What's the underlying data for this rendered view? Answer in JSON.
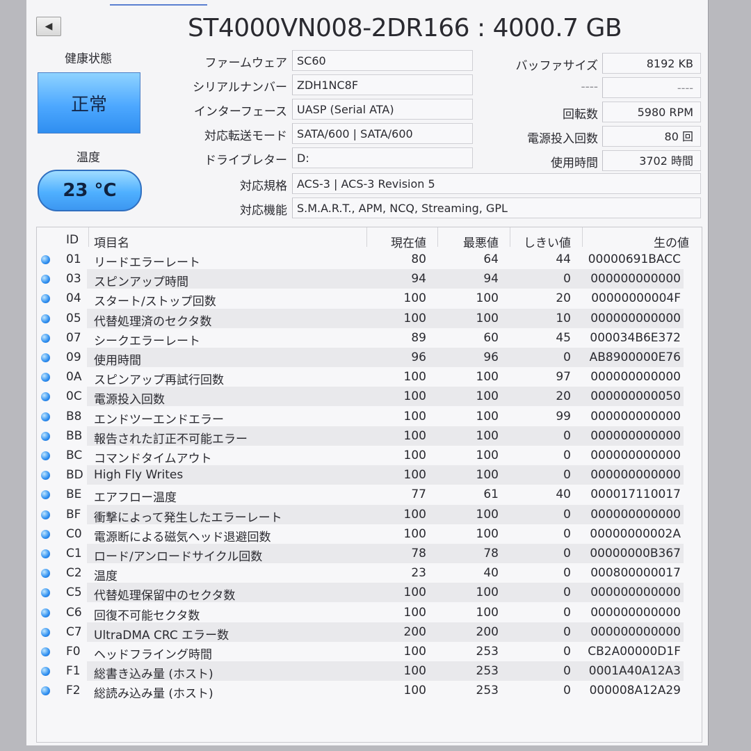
{
  "title": "ST4000VN008-2DR166 : 4000.7 GB",
  "health": {
    "label": "健康状態",
    "status": "正常"
  },
  "temperature": {
    "label": "温度",
    "value": "23 °C"
  },
  "info_left": [
    {
      "label": "ファームウェア",
      "value": "SC60"
    },
    {
      "label": "シリアルナンバー",
      "value": "ZDH1NC8F"
    },
    {
      "label": "インターフェース",
      "value": "UASP (Serial ATA)"
    },
    {
      "label": "対応転送モード",
      "value": "SATA/600 | SATA/600"
    },
    {
      "label": "ドライブレター",
      "value": "D:"
    },
    {
      "label": "対応規格",
      "value": "ACS-3 | ACS-3 Revision 5"
    },
    {
      "label": "対応機能",
      "value": "S.M.A.R.T., APM, NCQ, Streaming, GPL"
    }
  ],
  "info_right": [
    {
      "label": "バッファサイズ",
      "value": "8192 KB"
    },
    {
      "label": "----",
      "value": "----"
    },
    {
      "label": "回転数",
      "value": "5980 RPM"
    },
    {
      "label": "電源投入回数",
      "value": "80 回"
    },
    {
      "label": "使用時間",
      "value": "3702 時間"
    }
  ],
  "table": {
    "headers": {
      "id": "ID",
      "name": "項目名",
      "current": "現在値",
      "worst": "最悪値",
      "threshold": "しきい値",
      "raw": "生の値"
    },
    "rows": [
      {
        "id": "01",
        "name": "リードエラーレート",
        "current": "80",
        "worst": "64",
        "threshold": "44",
        "raw": "00000691BACC"
      },
      {
        "id": "03",
        "name": "スピンアップ時間",
        "current": "94",
        "worst": "94",
        "threshold": "0",
        "raw": "000000000000"
      },
      {
        "id": "04",
        "name": "スタート/ストップ回数",
        "current": "100",
        "worst": "100",
        "threshold": "20",
        "raw": "00000000004F"
      },
      {
        "id": "05",
        "name": "代替処理済のセクタ数",
        "current": "100",
        "worst": "100",
        "threshold": "10",
        "raw": "000000000000"
      },
      {
        "id": "07",
        "name": "シークエラーレート",
        "current": "89",
        "worst": "60",
        "threshold": "45",
        "raw": "000034B6E372"
      },
      {
        "id": "09",
        "name": "使用時間",
        "current": "96",
        "worst": "96",
        "threshold": "0",
        "raw": "AB8900000E76"
      },
      {
        "id": "0A",
        "name": "スピンアップ再試行回数",
        "current": "100",
        "worst": "100",
        "threshold": "97",
        "raw": "000000000000"
      },
      {
        "id": "0C",
        "name": "電源投入回数",
        "current": "100",
        "worst": "100",
        "threshold": "20",
        "raw": "000000000050"
      },
      {
        "id": "B8",
        "name": "エンドツーエンドエラー",
        "current": "100",
        "worst": "100",
        "threshold": "99",
        "raw": "000000000000"
      },
      {
        "id": "BB",
        "name": "報告された訂正不可能エラー",
        "current": "100",
        "worst": "100",
        "threshold": "0",
        "raw": "000000000000"
      },
      {
        "id": "BC",
        "name": "コマンドタイムアウト",
        "current": "100",
        "worst": "100",
        "threshold": "0",
        "raw": "000000000000"
      },
      {
        "id": "BD",
        "name": "High Fly Writes",
        "current": "100",
        "worst": "100",
        "threshold": "0",
        "raw": "000000000000"
      },
      {
        "id": "BE",
        "name": "エアフロー温度",
        "current": "77",
        "worst": "61",
        "threshold": "40",
        "raw": "000017110017"
      },
      {
        "id": "BF",
        "name": "衝撃によって発生したエラーレート",
        "current": "100",
        "worst": "100",
        "threshold": "0",
        "raw": "000000000000"
      },
      {
        "id": "C0",
        "name": "電源断による磁気ヘッド退避回数",
        "current": "100",
        "worst": "100",
        "threshold": "0",
        "raw": "00000000002A"
      },
      {
        "id": "C1",
        "name": "ロード/アンロードサイクル回数",
        "current": "78",
        "worst": "78",
        "threshold": "0",
        "raw": "00000000B367"
      },
      {
        "id": "C2",
        "name": "温度",
        "current": "23",
        "worst": "40",
        "threshold": "0",
        "raw": "000800000017"
      },
      {
        "id": "C5",
        "name": "代替処理保留中のセクタ数",
        "current": "100",
        "worst": "100",
        "threshold": "0",
        "raw": "000000000000"
      },
      {
        "id": "C6",
        "name": "回復不可能セクタ数",
        "current": "100",
        "worst": "100",
        "threshold": "0",
        "raw": "000000000000"
      },
      {
        "id": "C7",
        "name": "UltraDMA CRC エラー数",
        "current": "200",
        "worst": "200",
        "threshold": "0",
        "raw": "000000000000"
      },
      {
        "id": "F0",
        "name": "ヘッドフライング時間",
        "current": "100",
        "worst": "253",
        "threshold": "0",
        "raw": "CB2A00000D1F"
      },
      {
        "id": "F1",
        "name": "総書き込み量 (ホスト)",
        "current": "100",
        "worst": "253",
        "threshold": "0",
        "raw": "0001A40A12A3"
      },
      {
        "id": "F2",
        "name": "総読み込み量 (ホスト)",
        "current": "100",
        "worst": "253",
        "threshold": "0",
        "raw": "000008A12A29"
      }
    ]
  },
  "colors": {
    "status_blue": "#4da8ff",
    "dot_blue": "#2d8ef0"
  },
  "icons": {
    "back": "left-triangle-icon",
    "status": "blue-dot-icon"
  }
}
